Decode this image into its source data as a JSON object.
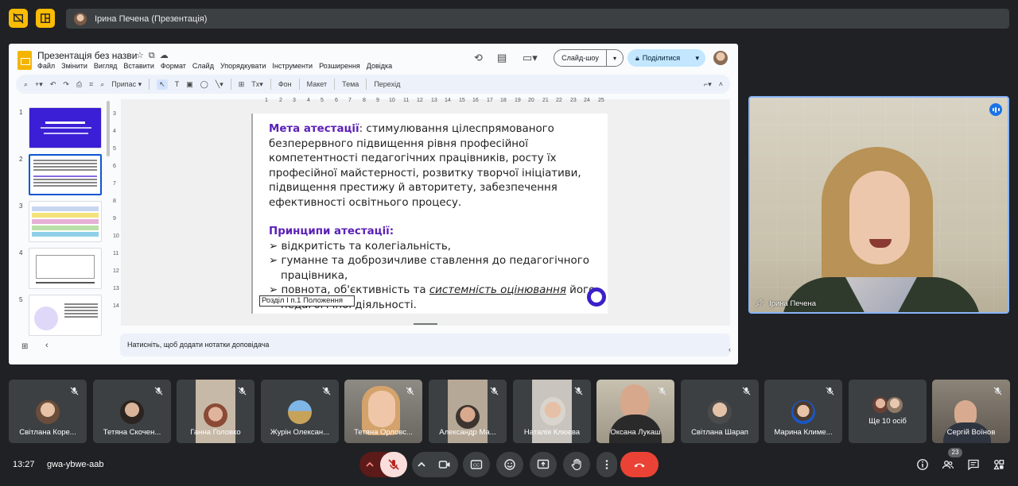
{
  "topbar": {
    "presenter_label": "Ірина Печена (Презентація)"
  },
  "slides_app": {
    "doc_title": "Презентація без назви",
    "menu": [
      "Файл",
      "Змінити",
      "Вигляд",
      "Вставити",
      "Формат",
      "Слайд",
      "Упорядкувати",
      "Інструменти",
      "Розширення",
      "Довідка"
    ],
    "slideshow_label": "Слайд-шоу",
    "share_label": "Поділитися",
    "toolbar": {
      "fit_label": "Припас",
      "background": "Фон",
      "layout": "Макет",
      "theme": "Тема",
      "transition": "Перехід"
    },
    "ruler_h": [
      "1",
      "2",
      "3",
      "4",
      "5",
      "6",
      "7",
      "8",
      "9",
      "10",
      "11",
      "12",
      "13",
      "14",
      "15",
      "16",
      "17",
      "18",
      "19",
      "20",
      "21",
      "22",
      "23",
      "24",
      "25"
    ],
    "ruler_v": [
      "3",
      "4",
      "5",
      "6",
      "7",
      "8",
      "9",
      "10",
      "11",
      "12",
      "13",
      "14"
    ],
    "slide_numbers": [
      "1",
      "2",
      "3",
      "4",
      "5"
    ],
    "notes_placeholder": "Натисніть, щоб додати нотатки доповідача",
    "slide": {
      "goal_heading": "Мета атестації",
      "goal_text": ": стимулювання цілеспрямованого безперервного підвищення рівня професійної компетентності педагогічних працівників, росту їх професійної майстерності, розвитку творчої ініціативи, підвищення престижу й авторитету, забезпечення ефективності освітнього процесу.",
      "principles_heading": "Принципи атестації:",
      "bullet_1": "відкритість та колегіальність,",
      "bullet_2": "гуманне та доброзичливе ставлення до педагогічного працівника,",
      "bullet_3_a": "повнота, об'єктивність та ",
      "bullet_3_em": "системність оцінювання",
      "bullet_3_b": " його педагогічної діяльності.",
      "footer": "Розділ І п.1 Положення"
    }
  },
  "speaker": {
    "name": "Ірина Печена"
  },
  "participants": [
    {
      "name": "Світлана Коре..."
    },
    {
      "name": "Тетяна Скочен..."
    },
    {
      "name": "Ганна Головко"
    },
    {
      "name": "Журін Олексан..."
    },
    {
      "name": "Тетяна Орловс..."
    },
    {
      "name": "Александр Ма..."
    },
    {
      "name": "Наталія Клюєва"
    },
    {
      "name": "Оксана Лукаш"
    },
    {
      "name": "Світлана Шарап"
    },
    {
      "name": "Марина Климе..."
    },
    {
      "name": "Ще 10 осіб"
    },
    {
      "name": "Сергій Воїнов"
    }
  ],
  "bottom_bar": {
    "time": "13:27",
    "meeting_code": "gwa-ybwe-aab",
    "people_count": "23"
  },
  "colors": {
    "meet_bg": "#202124",
    "tile_bg": "#3c4043",
    "mic_off_bg": "#f9dedc",
    "hangup": "#ea4335",
    "slide_heading": "#5b21b6",
    "accent_blue": "#8ab4f8"
  }
}
